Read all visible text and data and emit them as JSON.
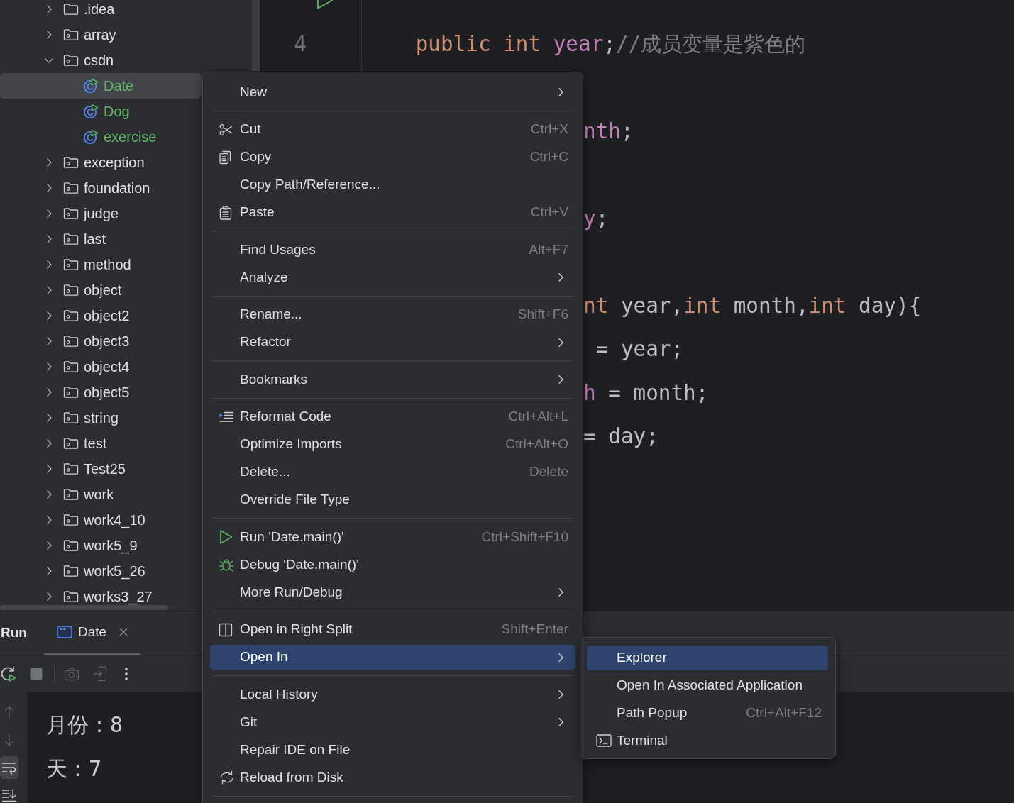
{
  "project_tree": {
    "items": [
      {
        "label": ".idea",
        "kind": "folder",
        "expanded": false,
        "selected": false
      },
      {
        "label": "array",
        "kind": "package",
        "expanded": false,
        "selected": false
      },
      {
        "label": "csdn",
        "kind": "package",
        "expanded": true,
        "selected": false,
        "children": [
          {
            "label": "Date",
            "kind": "class",
            "selected": true
          },
          {
            "label": "Dog",
            "kind": "class",
            "selected": false
          },
          {
            "label": "exercise",
            "kind": "class",
            "selected": false
          }
        ]
      },
      {
        "label": "exception",
        "kind": "package",
        "expanded": false,
        "selected": false
      },
      {
        "label": "foundation",
        "kind": "package",
        "expanded": false,
        "selected": false
      },
      {
        "label": "judge",
        "kind": "package",
        "expanded": false,
        "selected": false
      },
      {
        "label": "last",
        "kind": "package",
        "expanded": false,
        "selected": false
      },
      {
        "label": "method",
        "kind": "package",
        "expanded": false,
        "selected": false
      },
      {
        "label": "object",
        "kind": "package",
        "expanded": false,
        "selected": false
      },
      {
        "label": "object2",
        "kind": "package",
        "expanded": false,
        "selected": false
      },
      {
        "label": "object3",
        "kind": "package",
        "expanded": false,
        "selected": false
      },
      {
        "label": "object4",
        "kind": "package",
        "expanded": false,
        "selected": false
      },
      {
        "label": "object5",
        "kind": "package",
        "expanded": false,
        "selected": false
      },
      {
        "label": "string",
        "kind": "package",
        "expanded": false,
        "selected": false
      },
      {
        "label": "test",
        "kind": "package",
        "expanded": false,
        "selected": false
      },
      {
        "label": "Test25",
        "kind": "package",
        "expanded": false,
        "selected": false
      },
      {
        "label": "work",
        "kind": "package",
        "expanded": false,
        "selected": false
      },
      {
        "label": "work4_10",
        "kind": "package",
        "expanded": false,
        "selected": false
      },
      {
        "label": "work5_9",
        "kind": "package",
        "expanded": false,
        "selected": false
      },
      {
        "label": "work5_26",
        "kind": "package",
        "expanded": false,
        "selected": false
      },
      {
        "label": "works3_27",
        "kind": "package",
        "expanded": false,
        "selected": false
      }
    ]
  },
  "editor": {
    "lines": [
      {
        "run_marker": true
      },
      {
        "number": "4",
        "tokens": [
          {
            "text": "public",
            "kind": "keyword"
          },
          {
            "text": " int",
            "kind": "keyword"
          },
          {
            "text": " year",
            "kind": "field"
          },
          {
            "text": ";",
            "kind": "plain"
          },
          {
            "text": "//成员变量是紫色的",
            "kind": "comment"
          }
        ]
      },
      {
        "tokens": [
          {
            "text": "nth",
            "kind": "field"
          },
          {
            "text": ";",
            "kind": "plain"
          }
        ]
      },
      {
        "tokens": [
          {
            "text": "y",
            "kind": "field"
          },
          {
            "text": ";",
            "kind": "plain"
          }
        ]
      },
      {
        "tokens": [
          {
            "text": "nt",
            "kind": "keyword"
          },
          {
            "text": " year,",
            "kind": "plain"
          },
          {
            "text": "int",
            "kind": "keyword"
          },
          {
            "text": " month,",
            "kind": "plain"
          },
          {
            "text": "int",
            "kind": "keyword"
          },
          {
            "text": " day){",
            "kind": "plain"
          }
        ]
      },
      {
        "tokens": [
          {
            "text": "= year;",
            "kind": "plain"
          }
        ]
      },
      {
        "tokens": [
          {
            "text": "h",
            "kind": "field"
          },
          {
            "text": " = month;",
            "kind": "plain"
          }
        ]
      },
      {
        "tokens": [
          {
            "text": "= day;",
            "kind": "plain"
          }
        ]
      }
    ]
  },
  "context_menu": {
    "items": [
      {
        "kind": "item",
        "label": "New",
        "has_submenu": true,
        "selected": false
      },
      {
        "kind": "separator"
      },
      {
        "kind": "item",
        "label": "Cut",
        "shortcut": "Ctrl+X",
        "selected": false
      },
      {
        "kind": "item",
        "label": "Copy",
        "shortcut": "Ctrl+C",
        "selected": false
      },
      {
        "kind": "item",
        "label": "Copy Path/Reference...",
        "selected": false
      },
      {
        "kind": "item",
        "label": "Paste",
        "shortcut": "Ctrl+V",
        "selected": false
      },
      {
        "kind": "separator"
      },
      {
        "kind": "item",
        "label": "Find Usages",
        "shortcut": "Alt+F7",
        "selected": false
      },
      {
        "kind": "item",
        "label": "Analyze",
        "has_submenu": true,
        "selected": false
      },
      {
        "kind": "separator"
      },
      {
        "kind": "item",
        "label": "Rename...",
        "shortcut": "Shift+F6",
        "selected": false
      },
      {
        "kind": "item",
        "label": "Refactor",
        "has_submenu": true,
        "selected": false
      },
      {
        "kind": "separator"
      },
      {
        "kind": "item",
        "label": "Bookmarks",
        "has_submenu": true,
        "selected": false
      },
      {
        "kind": "separator"
      },
      {
        "kind": "item",
        "label": "Reformat Code",
        "shortcut": "Ctrl+Alt+L",
        "selected": false
      },
      {
        "kind": "item",
        "label": "Optimize Imports",
        "shortcut": "Ctrl+Alt+O",
        "selected": false
      },
      {
        "kind": "item",
        "label": "Delete...",
        "shortcut": "Delete",
        "selected": false
      },
      {
        "kind": "item",
        "label": "Override File Type",
        "selected": false
      },
      {
        "kind": "separator"
      },
      {
        "kind": "item",
        "label": "Run 'Date.main()'",
        "shortcut": "Ctrl+Shift+F10",
        "selected": false
      },
      {
        "kind": "item",
        "label": "Debug 'Date.main()'",
        "selected": false
      },
      {
        "kind": "item",
        "label": "More Run/Debug",
        "has_submenu": true,
        "selected": false
      },
      {
        "kind": "separator"
      },
      {
        "kind": "item",
        "label": "Open in Right Split",
        "shortcut": "Shift+Enter",
        "selected": false
      },
      {
        "kind": "item",
        "label": "Open In",
        "has_submenu": true,
        "selected": true
      },
      {
        "kind": "separator"
      },
      {
        "kind": "item",
        "label": "Local History",
        "has_submenu": true,
        "selected": false
      },
      {
        "kind": "item",
        "label": "Git",
        "has_submenu": true,
        "selected": false
      },
      {
        "kind": "item",
        "label": "Repair IDE on File",
        "selected": false
      },
      {
        "kind": "item",
        "label": "Reload from Disk",
        "selected": false
      },
      {
        "kind": "separator"
      }
    ]
  },
  "submenu": {
    "items": [
      {
        "kind": "item",
        "label": "Explorer",
        "selected": true
      },
      {
        "kind": "item",
        "label": "Open In Associated Application",
        "selected": false
      },
      {
        "kind": "item",
        "label": "Path Popup",
        "shortcut": "Ctrl+Alt+F12",
        "selected": false
      },
      {
        "kind": "item",
        "label": "Terminal",
        "selected": false
      }
    ]
  },
  "run_panel": {
    "title": "Run",
    "tabs": [
      {
        "label": "Date",
        "selected": true,
        "closable": true
      }
    ],
    "toolbar": [
      {
        "disabled": false
      },
      {
        "disabled": true
      },
      {
        "disabled": true
      },
      {
        "disabled": true
      },
      {
        "disabled": false
      }
    ],
    "side_buttons": [
      {
        "disabled": true,
        "on": false
      },
      {
        "disabled": true,
        "on": false
      },
      {
        "disabled": false,
        "on": true
      },
      {
        "disabled": false,
        "on": false
      }
    ],
    "console_lines": [
      "月份：8",
      "天：7"
    ]
  }
}
